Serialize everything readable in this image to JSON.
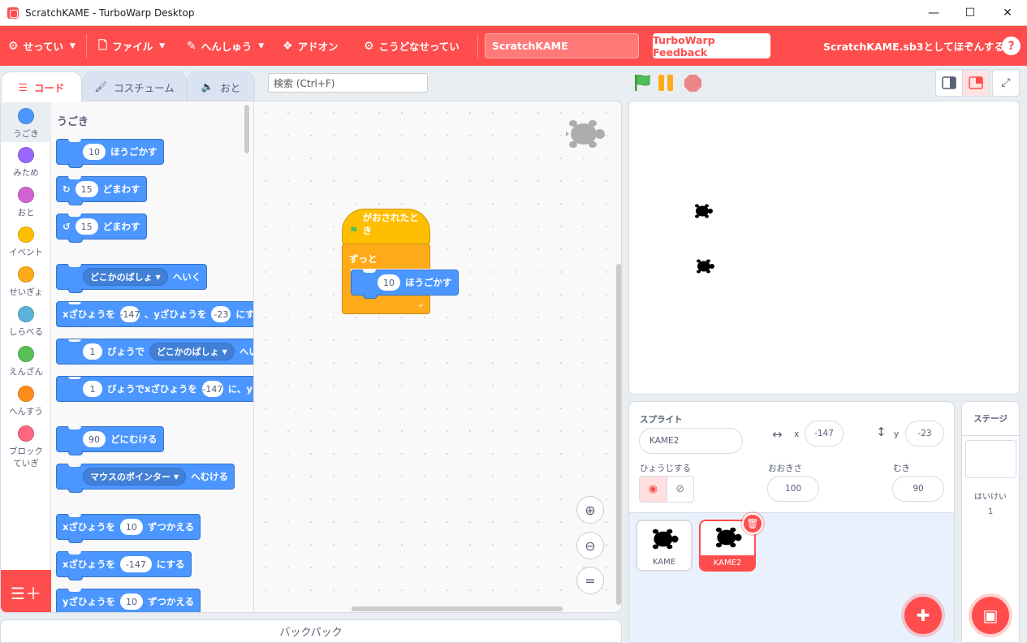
{
  "window": {
    "title": "ScratchKAME - TurboWarp Desktop"
  },
  "menubar": {
    "settings": "せってい",
    "file": "ファイル",
    "edit": "へんしゅう",
    "addons": "アドオン",
    "how_to": "こうどなせってい",
    "project_title": "ScratchKAME",
    "feedback": "TurboWarp Feedback",
    "save_status": "ScratchKAME.sb3としてほぞんする",
    "help": "?"
  },
  "tabs": {
    "code": "コード",
    "costumes": "コスチューム",
    "sounds": "おと"
  },
  "search": {
    "placeholder": "検索 (Ctrl+F)"
  },
  "categories": [
    {
      "label": "うごき",
      "color": "#4c97ff"
    },
    {
      "label": "みため",
      "color": "#9966ff"
    },
    {
      "label": "おと",
      "color": "#cf63cf"
    },
    {
      "label": "イベント",
      "color": "#ffbf00"
    },
    {
      "label": "せいぎょ",
      "color": "#ffab19"
    },
    {
      "label": "しらべる",
      "color": "#5cb1d6"
    },
    {
      "label": "えんざん",
      "color": "#59c059"
    },
    {
      "label": "へんすう",
      "color": "#ff8c1a"
    },
    {
      "label": "ブロックていぎ",
      "color": "#ff6680"
    }
  ],
  "palette": {
    "title": "うごき",
    "move": {
      "value": "10",
      "text": "ほうごかす"
    },
    "turn_right": {
      "value": "15",
      "text": "どまわす"
    },
    "turn_left": {
      "value": "15",
      "text": "どまわす"
    },
    "goto": {
      "target": "どこかのばしょ",
      "text": "へいく"
    },
    "goto_xy": {
      "t1": "xざひょうを",
      "x": "-147",
      "t2": "、yざひょうを",
      "y": "-23",
      "t3": "にす"
    },
    "glide": {
      "secs": "1",
      "t1": "びょうで",
      "target": "どこかのばしょ",
      "t2": "へい"
    },
    "glide_xy": {
      "secs": "1",
      "t1": "びょうでxざひょうを",
      "x": "-147",
      "t2": "に、y"
    },
    "point_dir": {
      "value": "90",
      "text": "どにむける"
    },
    "point_towards": {
      "target": "マウスのポインター",
      "text": "へむける"
    },
    "change_x": {
      "t1": "xざひょうを",
      "value": "10",
      "t2": "ずつかえる"
    },
    "set_x": {
      "t1": "xざひょうを",
      "value": "-147",
      "t2": "にする"
    },
    "change_y": {
      "t1": "yざひょうを",
      "value": "10",
      "t2": "ずつかえる"
    }
  },
  "script": {
    "hat": "がおされたとき",
    "forever": "ずっと",
    "move_value": "10",
    "move_text": "ほうごかす"
  },
  "backpack": "バックパック",
  "sprite_info": {
    "sprite_label": "スプライト",
    "sprite_name": "KAME2",
    "x_label": "x",
    "x": "-147",
    "y_label": "y",
    "y": "-23",
    "show_label": "ひょうじする",
    "size_label": "おおきさ",
    "size": "100",
    "direction_label": "むき",
    "direction": "90"
  },
  "sprites": [
    {
      "name": "KAME",
      "selected": false
    },
    {
      "name": "KAME2",
      "selected": true
    }
  ],
  "stage_pane": {
    "title": "ステージ",
    "backdrops_label": "はいけい",
    "backdrops_count": "1"
  }
}
